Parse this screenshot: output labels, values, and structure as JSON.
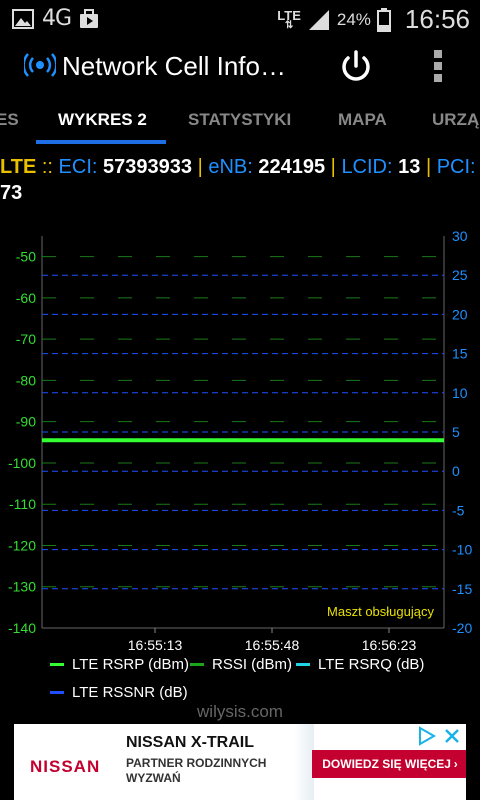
{
  "status_bar": {
    "network_type": "4G",
    "lte_label": "LTE",
    "battery": "24%",
    "time": "16:56",
    "icons": [
      "image-icon",
      "briefcase-icon",
      "signal-icon",
      "battery-icon"
    ]
  },
  "app_bar": {
    "title": "Network Cell Info…",
    "icons": [
      "broadcast-icon",
      "power-icon",
      "overflow-menu-icon"
    ]
  },
  "tabs": {
    "items": [
      {
        "label": "ES"
      },
      {
        "label": "WYKRES 2",
        "active": true
      },
      {
        "label": "STATYSTYKI"
      },
      {
        "label": "MAPA"
      },
      {
        "label": "URZĄ"
      }
    ]
  },
  "cell_info": {
    "tech": "LTE",
    "sep": "::",
    "eci_label": "ECI:",
    "eci": "57393933",
    "enb_label": "eNB:",
    "enb": "224195",
    "lcid_label": "LCID:",
    "lcid": "13",
    "pci_label": "PCI:",
    "pci": "73"
  },
  "chart_data": {
    "type": "line",
    "y_left": {
      "ticks": [
        "-50",
        "-60",
        "-70",
        "-80",
        "-90",
        "-100",
        "-110",
        "-120",
        "-130",
        "-140"
      ],
      "range": [
        -140,
        -45
      ]
    },
    "y_right": {
      "ticks": [
        "30",
        "25",
        "20",
        "15",
        "10",
        "5",
        "0",
        "-5",
        "-10",
        "-15",
        "-20"
      ],
      "range": [
        -20,
        30
      ]
    },
    "x_ticks": [
      "16:55:13",
      "16:55:48",
      "16:56:23"
    ],
    "grid": true,
    "series": [
      {
        "name": "LTE RSRP (dBm)",
        "color": "#33ff33",
        "values": [
          -94.5,
          -94.5
        ]
      }
    ],
    "annotation": "Maszt obsługujący",
    "colors": {
      "rsrp": "#33ff33",
      "rssi": "#1aa61a",
      "rsrq": "#22d3e6",
      "rssnr": "#1e50ff",
      "right_axis": "#1e90ff",
      "left_axis": "#33dd33"
    }
  },
  "legend": {
    "items": [
      {
        "label": "LTE RSRP (dBm)",
        "color": "#33ff33"
      },
      {
        "label": "RSSI (dBm)",
        "color": "#1aa61a"
      },
      {
        "label": "LTE RSRQ (dB)",
        "color": "#22d3e6"
      },
      {
        "label": "LTE RSSNR (dB)",
        "color": "#1e50ff"
      }
    ]
  },
  "watermark": "wilysis.com",
  "ad": {
    "brand": "NISSAN",
    "headline": "NISSAN X-TRAIL",
    "sub": "PARTNER RODZINNYCH WYZWAŃ",
    "cta": "DOWIEDZ SIĘ WIĘCEJ",
    "cta_arrow": "›"
  }
}
